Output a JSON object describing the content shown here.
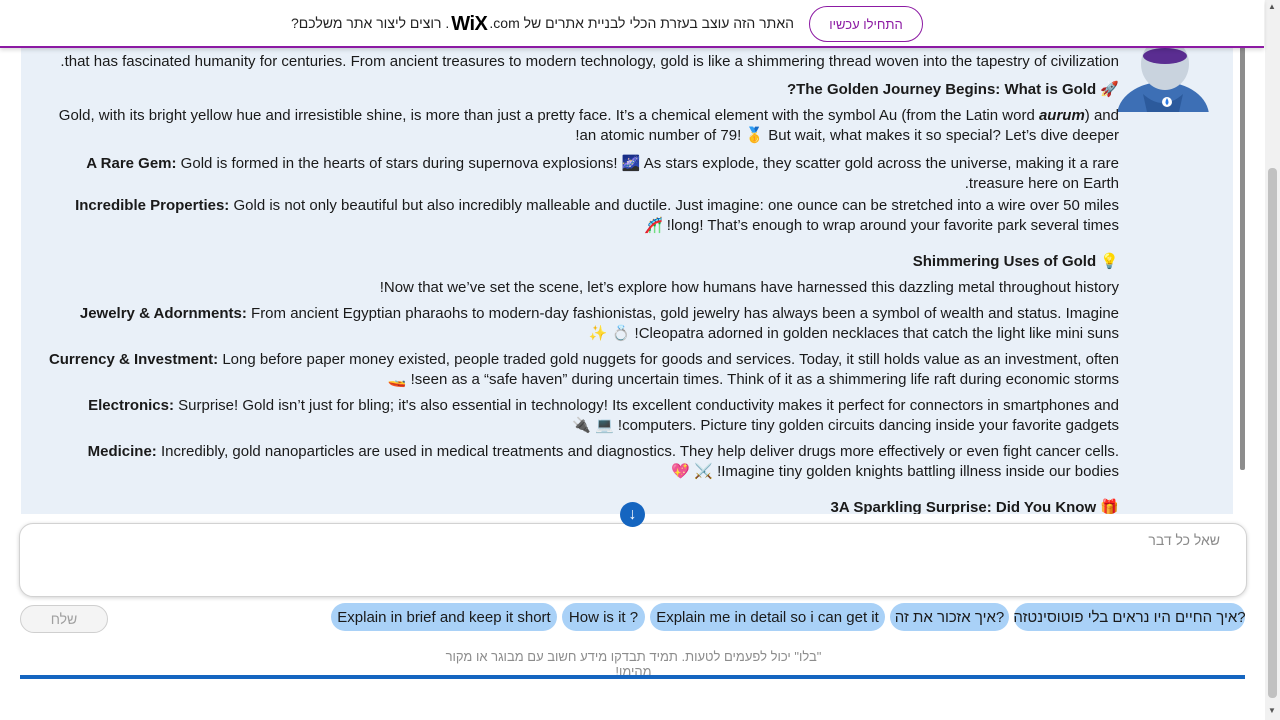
{
  "banner": {
    "text_before": "האתר הזה עוצב בעזרת הכלי לבניית אתרים של",
    "logo": "WiX",
    "logo_suffix": ".com",
    "text_after": ". רוצים ליצור אתר משלכם?",
    "cta": "התחילו עכשיו"
  },
  "message": {
    "intro": "that has fascinated humanity for centuries. From ancient treasures to modern technology, gold is like a shimmering thread woven into the tapestry of civilization.",
    "h1": "The Golden Journey Begins: What is Gold?",
    "h1_emoji": "🚀",
    "p1a": "Gold, with its bright yellow hue and irresistible shine, is more than just a pretty face. It’s a chemical element with the symbol Au (from the Latin word ",
    "p1_italic": "aurum",
    "p1b": ") and an atomic number of 79! 🥇 But wait, what makes it so special? Let’s dive deeper!",
    "rare_label": "A Rare Gem:",
    "rare_text": " Gold is formed in the hearts of stars during supernova explosions! 🌌 As stars explode, they scatter gold across the universe, making it a rare treasure here on Earth.",
    "props_label": "Incredible Properties:",
    "props_text": " Gold is not only beautiful but also incredibly malleable and ductile. Just imagine: one ounce can be stretched into a wire over 50 miles long! That’s enough to wrap around your favorite park several times! 🎢",
    "h2": "Shimmering Uses of Gold",
    "h2_emoji": "💡",
    "p2": "Now that we’ve set the scene, let’s explore how humans have harnessed this dazzling metal throughout history!",
    "jewelry_label": "Jewelry & Adornments:",
    "jewelry_text": " From ancient Egyptian pharaohs to modern-day fashionistas, gold jewelry has always been a symbol of wealth and status. Imagine Cleopatra adorned in golden necklaces that catch the light like mini suns! 💍 ✨",
    "currency_label": "Currency & Investment:",
    "currency_text": " Long before paper money existed, people traded gold nuggets for goods and services. Today, it still holds value as an investment, often seen as a “safe haven” during uncertain times. Think of it as a shimmering life raft during economic storms! 🚤",
    "electronics_label": "Electronics:",
    "electronics_text": " Surprise! Gold isn’t just for bling; it's also essential in technology! Its excellent conductivity makes it perfect for connectors in smartphones and computers. Picture tiny golden circuits dancing inside your favorite gadgets! 💻 🔌",
    "medicine_label": "Medicine:",
    "medicine_text": " Incredibly, gold nanoparticles are used in medical treatments and diagnostics. They help deliver drugs more effectively or even fight cancer cells. Imagine tiny golden knights battling illness inside our bodies! ⚔️ 💖",
    "h3": "3A Sparkling Surprise: Did You Know",
    "h3_emoji": "🎁"
  },
  "input": {
    "placeholder": "שאל כל דבר"
  },
  "send_label": "שלח",
  "chips": [
    "איך החיים היו נראים בלי פוטוסינטזה?",
    "איך אזכור את זה?",
    "Explain me in detail so i can get it",
    "How is it ?",
    "Explain in brief and keep it short"
  ],
  "disclaimer": "\"בלו\" יכול לפעמים לטעות. תמיד תבדקו מידע חשוב עם מבוגר או מקור מהימן!",
  "colors": {
    "accent": "#1565c0",
    "chip": "#a9d1f7",
    "wix_purple": "#8c1aa3",
    "panel": "#e9f0f8"
  }
}
